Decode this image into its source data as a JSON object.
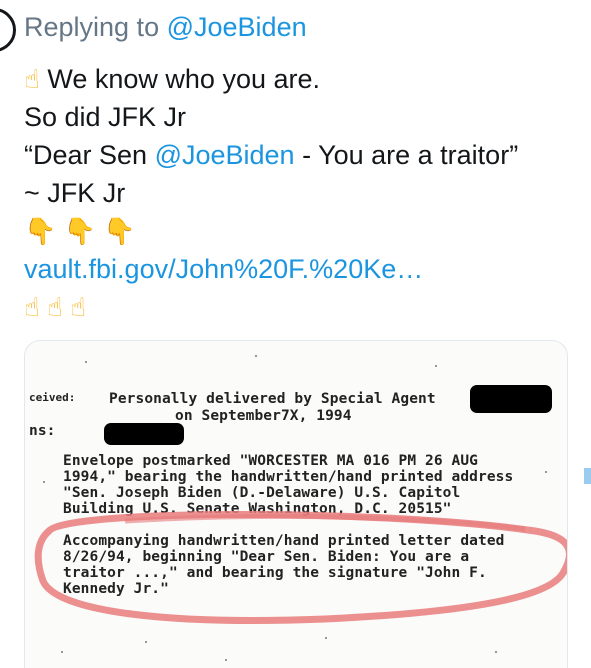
{
  "reply": {
    "prefix": "Replying to",
    "handle": "@JoeBiden"
  },
  "tweet": {
    "point_up_emoji": "☝",
    "line1": "We know who you are.",
    "line2": "So did JFK Jr",
    "quote_open": "“Dear Sen ",
    "quote_handle": "@JoeBiden",
    "quote_close": " - You are a traitor”",
    "signoff": "~ JFK Jr",
    "point_down_emojis": "👇 👇 👇",
    "link_text": "vault.fbi.gov/John%20F.%20Ke…",
    "victory_emojis": "☝ ☝ ☝"
  },
  "document": {
    "label_received": "ceived:",
    "label_ns": "ns:",
    "delivered_line1": "Personally delivered by Special Agent",
    "delivered_line2": "on September7X, 1994",
    "env1": "Envelope postmarked \"WORCESTER MA 016  PM  26 AUG",
    "env2": "1994,\" bearing the handwritten/hand printed address",
    "env3": "\"Sen. Joseph Biden  (D.-Delaware)  U.S. Capitol",
    "env4": "Building  U.S. Senate  Washington, D.C. 20515\"",
    "acc1": "Accompanying handwritten/hand printed letter dated",
    "acc2": "8/26/94, beginning \"Dear Sen. Biden:  You are a",
    "acc3": "traitor ...,\" and bearing the signature \"John F.",
    "acc4": "Kennedy Jr.\""
  },
  "colors": {
    "link": "#1b95e0",
    "meta": "#657786",
    "circle": "#e77b7b"
  }
}
